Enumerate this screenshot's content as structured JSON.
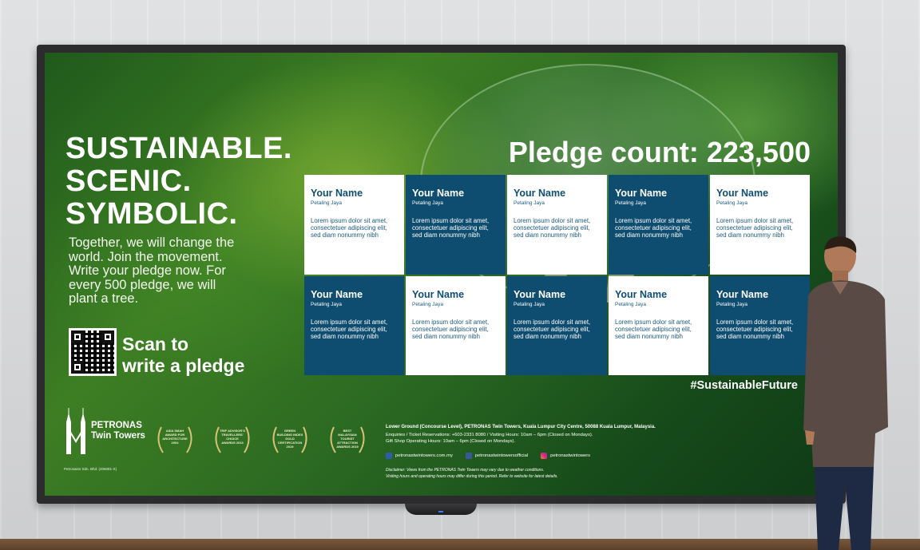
{
  "headline": [
    "SUSTAINABLE.",
    "SCENIC.",
    "SYMBOLIC."
  ],
  "intro": "Together, we will change the world. Join the movement. Write your pledge now. For every 500 pledge, we will plant a tree.",
  "scan": [
    "Scan to",
    "write a pledge"
  ],
  "pledge_count": "Pledge count: 223,500",
  "cards": [
    {
      "name": "Your Name",
      "location": "Petaling Jaya",
      "text": "Lorem ipsum dolor sit amet, consectetuer adipiscing elit, sed diam nonummy nibh",
      "theme": "white"
    },
    {
      "name": "Your Name",
      "location": "Petaling Jaya",
      "text": "Lorem ipsum dolor sit amet, consectetuer adipiscing elit, sed diam nonummy nibh",
      "theme": "blue"
    },
    {
      "name": "Your Name",
      "location": "Petaling Jaya",
      "text": "Lorem ipsum dolor sit amet, consectetuer adipiscing elit, sed diam nonummy nibh",
      "theme": "white"
    },
    {
      "name": "Your Name",
      "location": "Petaling Jaya",
      "text": "Lorem ipsum dolor sit amet, consectetuer adipiscing elit, sed diam nonummy nibh",
      "theme": "blue"
    },
    {
      "name": "Your Name",
      "location": "Petaling Jaya",
      "text": "Lorem ipsum dolor sit amet, consectetuer adipiscing elit, sed diam nonummy nibh",
      "theme": "white"
    },
    {
      "name": "Your Name",
      "location": "Petaling Jaya",
      "text": "Lorem ipsum dolor sit amet, consectetuer adipiscing elit, sed diam nonummy nibh",
      "theme": "blue"
    },
    {
      "name": "Your Name",
      "location": "Petaling Jaya",
      "text": "Lorem ipsum dolor sit amet, consectetuer adipiscing elit, sed diam nonummy nibh",
      "theme": "white"
    },
    {
      "name": "Your Name",
      "location": "Petaling Jaya",
      "text": "Lorem ipsum dolor sit amet, consectetuer adipiscing elit, sed diam nonummy nibh",
      "theme": "blue"
    },
    {
      "name": "Your Name",
      "location": "Petaling Jaya",
      "text": "Lorem ipsum dolor sit amet, consectetuer adipiscing elit, sed diam nonummy nibh",
      "theme": "white"
    },
    {
      "name": "Your Name",
      "location": "Petaling Jaya",
      "text": "Lorem ipsum dolor sit amet, consectetuer adipiscing elit, sed diam nonummy nibh",
      "theme": "blue"
    }
  ],
  "hashtag": "#SustainableFuture",
  "logo": {
    "line1": "PETRONAS",
    "line2": "Twin Towers"
  },
  "reg_no": "Petrosains Sdn. Bhd. (406081-X)",
  "awards": [
    {
      "text": "ASIA SMAH AWARD FOR ARCHITECTURE 2004"
    },
    {
      "text": "TRIP ADVISOR'S TRAVELLERS' CHOICE AWARDS 2013"
    },
    {
      "text": "GREEN BUILDING INDEX GOLD CERTIFICATION 2019"
    },
    {
      "text": "BEST MALAYSIAN TOURIST ATTRACTION AWARDS 2019"
    }
  ],
  "info": {
    "address": "Lower Ground (Concourse Level), PETRONAS Twin Towers, Kuala Lumpur City Centre, 50088 Kuala Lumpur, Malaysia.",
    "enquiries": "Enquiries / Ticket Reservations: +603-2331 8080 / Visiting Hours: 10am – 6pm (Closed on Mondays).",
    "gift_shop": "Gift Shop Operating Hours: 10am – 6pm (Closed on Mondays).",
    "socials": [
      {
        "icon": "web-icon",
        "label": "petronastwintowers.com.my"
      },
      {
        "icon": "facebook-icon",
        "label": "petronastwintowersofficial"
      },
      {
        "icon": "instagram-icon",
        "label": "petronastwintowers"
      }
    ],
    "disclaimer_1": "Disclaimer: Views from the PETRONAS Twin Towers may vary due to weather conditions.",
    "disclaimer_2": "Visiting hours and operating hours may differ during this period. Refer to website for latest details."
  },
  "colors": {
    "card_blue": "#0f4d70",
    "card_white": "#ffffff",
    "accent_text": "#104e73"
  }
}
